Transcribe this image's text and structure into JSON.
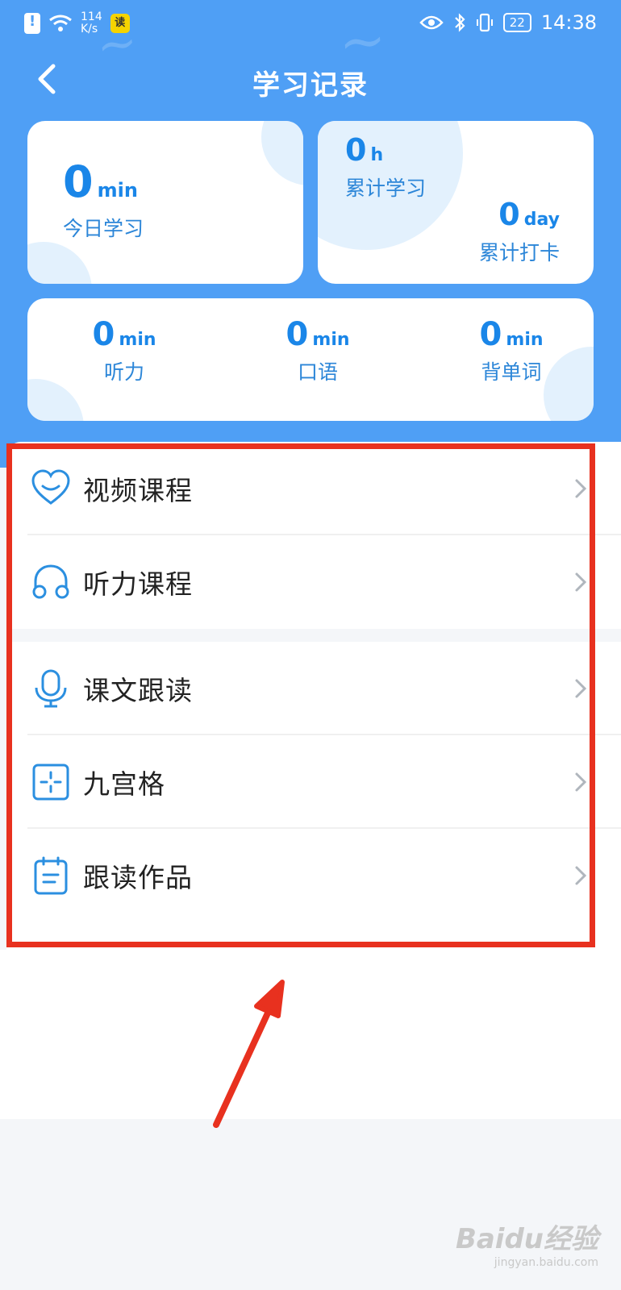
{
  "status_bar": {
    "net_speed_value": "114",
    "net_speed_unit": "K/s",
    "app_badge": "读",
    "battery": "22",
    "time": "14:38"
  },
  "nav": {
    "title": "学习记录"
  },
  "stats": {
    "today": {
      "value": "0",
      "unit": "min",
      "label": "今日学习"
    },
    "total_hours": {
      "value": "0",
      "unit": "h",
      "label": "累计学习"
    },
    "total_days": {
      "value": "0",
      "unit": "day",
      "label": "累计打卡"
    },
    "listening": {
      "value": "0",
      "unit": "min",
      "label": "听力"
    },
    "speaking": {
      "value": "0",
      "unit": "min",
      "label": "口语"
    },
    "vocab": {
      "value": "0",
      "unit": "min",
      "label": "背单词"
    }
  },
  "menu": [
    {
      "label": "视频课程",
      "icon": "heart-icon"
    },
    {
      "label": "听力课程",
      "icon": "headphones-icon"
    },
    {
      "label": "课文跟读",
      "icon": "microphone-icon"
    },
    {
      "label": "九宫格",
      "icon": "grid-icon"
    },
    {
      "label": "跟读作品",
      "icon": "calendar-icon"
    }
  ],
  "watermark": {
    "main": "Baidu经验",
    "sub": "jingyan.baidu.com"
  },
  "colors": {
    "hero": "#4f9ff5",
    "accent": "#1a86e8",
    "highlight": "#e8311f"
  }
}
